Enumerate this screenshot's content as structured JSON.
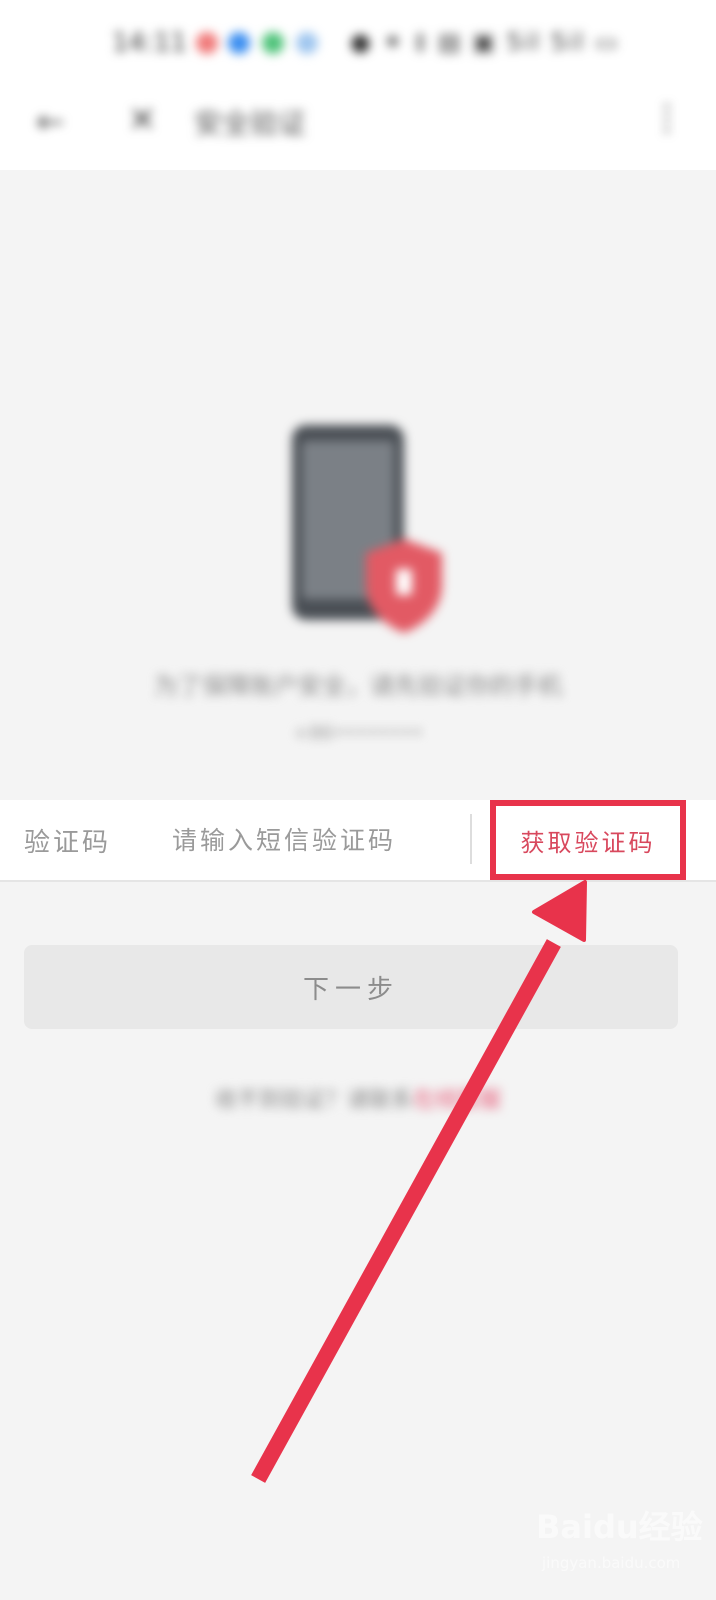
{
  "status_bar": {
    "time": "14:11",
    "signal_text": "● ✶ ‡ ▤ ▣ 5il 5il ▭",
    "notification_dot_colors": [
      "#f07a7a",
      "#3b8ef0",
      "#4fc37a",
      "#9fc6ef"
    ]
  },
  "nav": {
    "back_icon": "back-arrow-icon",
    "close_icon": "close-icon",
    "title": "安全验证",
    "more_icon": "more-vertical-icon"
  },
  "illustration": {
    "icon": "phone-shield-icon",
    "tip": "为了保障账户安全，请先验证你的手机",
    "sub": "+86••••••••"
  },
  "code_form": {
    "label": "验证码",
    "placeholder": "请输入短信验证码",
    "get_code_label": "获取验证码"
  },
  "next_button": {
    "label": "下一步"
  },
  "help": {
    "text": "收不到验证？请联系",
    "link": "在线客服"
  },
  "colors": {
    "accent": "#e65b78",
    "annotation": "#e8334b",
    "background": "#f4f4f4"
  },
  "watermark": {
    "brand": "Bai​du经验",
    "url": "jingyan.baidu.com"
  }
}
